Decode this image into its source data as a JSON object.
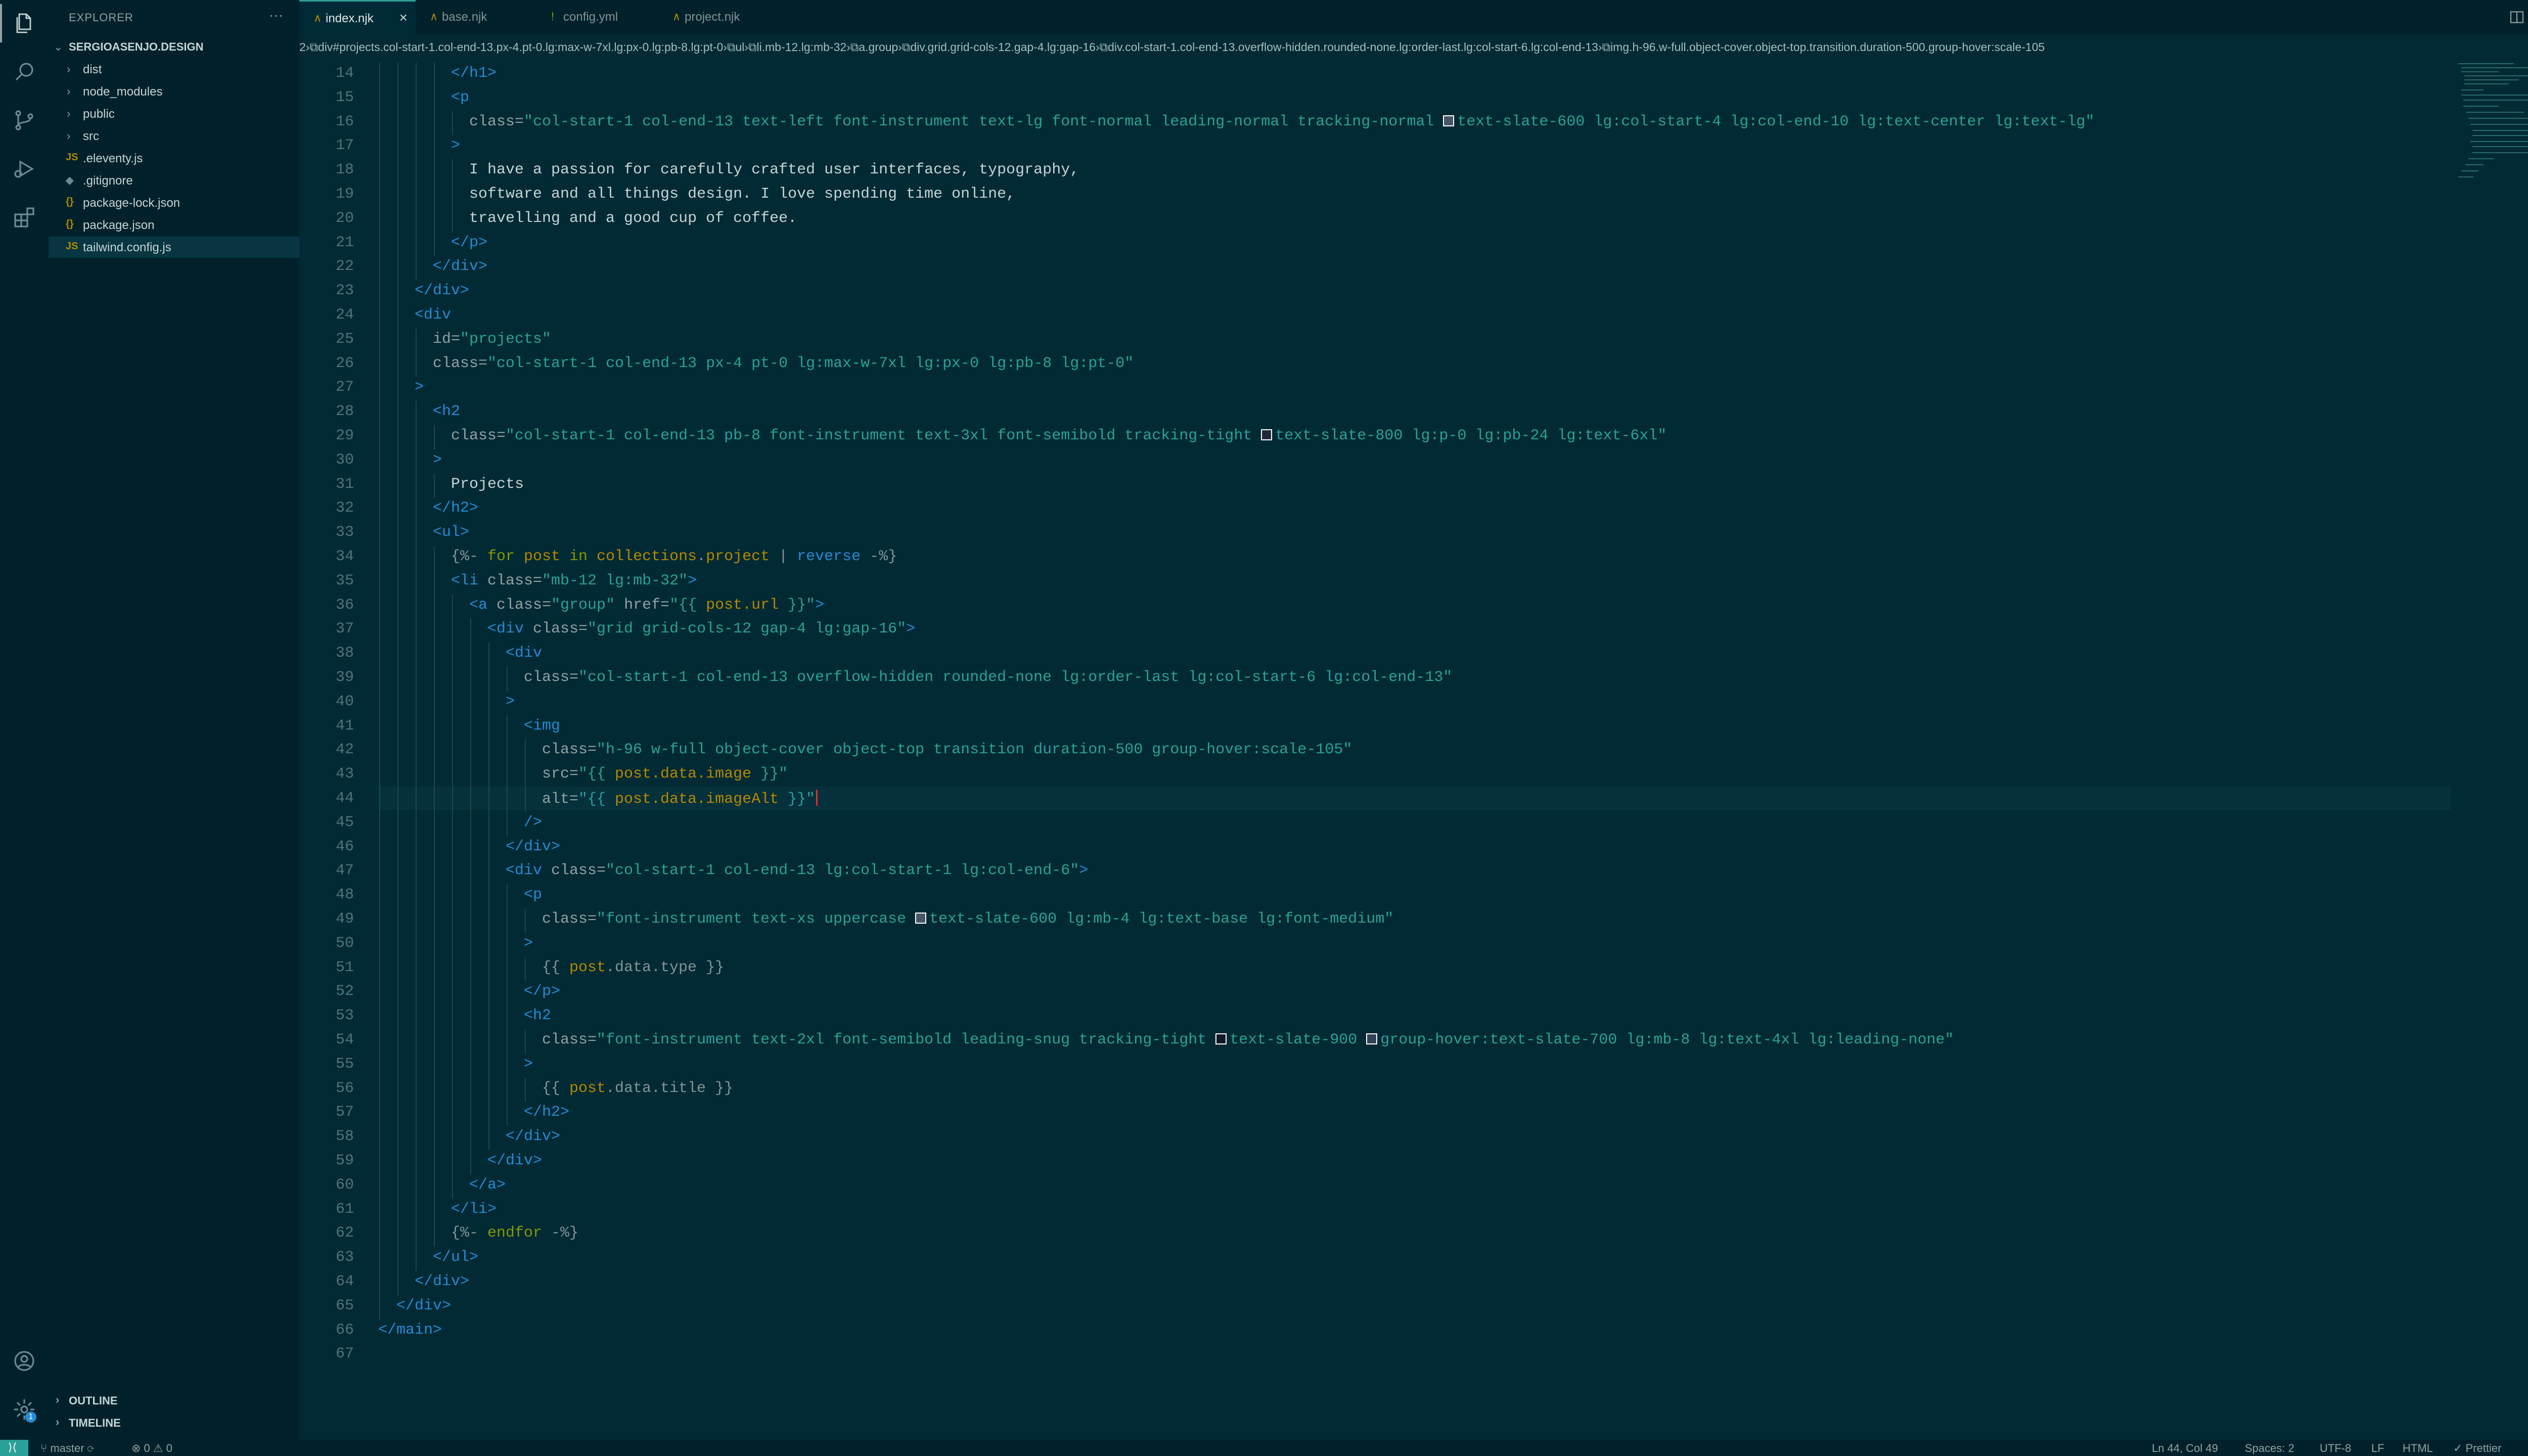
{
  "sidebar": {
    "title": "EXPLORER",
    "more": "···",
    "root": "SERGIOASENJO.DESIGN",
    "items": [
      {
        "label": "dist",
        "kind": "folder"
      },
      {
        "label": "node_modules",
        "kind": "folder"
      },
      {
        "label": "public",
        "kind": "folder"
      },
      {
        "label": "src",
        "kind": "folder"
      },
      {
        "label": ".eleventy.js",
        "kind": "js",
        "icon": "JS"
      },
      {
        "label": ".gitignore",
        "kind": "ignore",
        "icon": "◆"
      },
      {
        "label": "package-lock.json",
        "kind": "json",
        "icon": "{}"
      },
      {
        "label": "package.json",
        "kind": "json",
        "icon": "{}"
      },
      {
        "label": "tailwind.config.js",
        "kind": "js",
        "icon": "JS"
      }
    ],
    "outline": "OUTLINE",
    "timeline": "TIMELINE"
  },
  "tabs": [
    {
      "label": "index.njk",
      "icon": "∧",
      "close": "×"
    },
    {
      "label": "base.njk",
      "icon": "∧"
    },
    {
      "label": "config.yml",
      "icon": "!"
    },
    {
      "label": "project.njk",
      "icon": "∧"
    }
  ],
  "breadcrumb": [
    "2",
    "div#projects.col-start-1.col-end-13.px-4.pt-0.lg:max-w-7xl.lg:px-0.lg:pb-8.lg:pt-0",
    "ul",
    "li.mb-12.lg:mb-32",
    "a.group",
    "div.grid.grid-cols-12.gap-4.lg:gap-16",
    "div.col-start-1.col-end-13.overflow-hidden.rounded-none.lg:order-last.lg:col-start-6.lg:col-end-13",
    "img.h-96.w-full.object-cover.object-top.transition.duration-500.group-hover:scale-105"
  ],
  "editor": {
    "lines": [
      {
        "n": "14",
        "indent": 4,
        "parts": [
          [
            "t-tag",
            "</h1>"
          ]
        ]
      },
      {
        "n": "15",
        "indent": 4,
        "parts": [
          [
            "t-tag",
            "<p"
          ]
        ]
      },
      {
        "n": "16",
        "indent": 5,
        "parts": [
          [
            "t-attr",
            "class="
          ],
          [
            "t-str",
            "\"col-start-1 col-end-13 text-left font-instrument text-lg font-normal leading-normal tracking-normal "
          ],
          [
            "sw",
            "#475569"
          ],
          [
            "t-str",
            "text-slate-600 lg:col-start-4 lg:col-end-10 lg:text-center lg:text-lg\""
          ]
        ]
      },
      {
        "n": "17",
        "indent": 4,
        "parts": [
          [
            "t-tag",
            ">"
          ]
        ]
      },
      {
        "n": "18",
        "indent": 5,
        "parts": [
          [
            "t-txt",
            "I have a passion for carefully crafted user interfaces, typography,"
          ]
        ]
      },
      {
        "n": "19",
        "indent": 5,
        "parts": [
          [
            "t-txt",
            "software and all things design. I love spending time online,"
          ]
        ]
      },
      {
        "n": "20",
        "indent": 5,
        "parts": [
          [
            "t-txt",
            "travelling and a good cup of coffee."
          ]
        ]
      },
      {
        "n": "21",
        "indent": 4,
        "parts": [
          [
            "t-tag",
            "</p>"
          ]
        ]
      },
      {
        "n": "22",
        "indent": 3,
        "parts": [
          [
            "t-tag",
            "</div>"
          ]
        ]
      },
      {
        "n": "23",
        "indent": 2,
        "parts": [
          [
            "t-tag",
            "</div>"
          ]
        ]
      },
      {
        "n": "24",
        "indent": 2,
        "parts": [
          [
            "t-tag",
            "<div"
          ]
        ]
      },
      {
        "n": "25",
        "indent": 3,
        "parts": [
          [
            "t-attr",
            "id="
          ],
          [
            "t-str",
            "\"projects\""
          ]
        ]
      },
      {
        "n": "26",
        "indent": 3,
        "parts": [
          [
            "t-attr",
            "class="
          ],
          [
            "t-str",
            "\"col-start-1 col-end-13 px-4 pt-0 lg:max-w-7xl lg:px-0 lg:pb-8 lg:pt-0\""
          ]
        ]
      },
      {
        "n": "27",
        "indent": 2,
        "parts": [
          [
            "t-tag",
            ">"
          ]
        ]
      },
      {
        "n": "28",
        "indent": 3,
        "parts": [
          [
            "t-tag",
            "<h2"
          ]
        ]
      },
      {
        "n": "29",
        "indent": 4,
        "parts": [
          [
            "t-attr",
            "class="
          ],
          [
            "t-str",
            "\"col-start-1 col-end-13 pb-8 font-instrument text-3xl font-semibold tracking-tight "
          ],
          [
            "sw",
            "#1e293b"
          ],
          [
            "t-str",
            "text-slate-800 lg:p-0 lg:pb-24 lg:text-6xl\""
          ]
        ]
      },
      {
        "n": "30",
        "indent": 3,
        "parts": [
          [
            "t-tag",
            ">"
          ]
        ]
      },
      {
        "n": "31",
        "indent": 4,
        "parts": [
          [
            "t-txt",
            "Projects"
          ]
        ]
      },
      {
        "n": "32",
        "indent": 3,
        "parts": [
          [
            "t-tag",
            "</h2>"
          ]
        ]
      },
      {
        "n": "33",
        "indent": 3,
        "parts": [
          [
            "t-tag",
            "<ul>"
          ]
        ]
      },
      {
        "n": "34",
        "indent": 4,
        "parts": [
          [
            "t-op",
            "{%- "
          ],
          [
            "t-kw",
            "for "
          ],
          [
            "t-tpl",
            "post "
          ],
          [
            "t-kw",
            "in "
          ],
          [
            "t-tpl",
            "collections"
          ],
          [
            "t-op",
            "."
          ],
          [
            "t-tpl",
            "project "
          ],
          [
            "t-op",
            "| "
          ],
          [
            "t-tag",
            "reverse "
          ],
          [
            "t-op",
            "-%}"
          ]
        ]
      },
      {
        "n": "35",
        "indent": 4,
        "parts": [
          [
            "t-tag",
            "<li "
          ],
          [
            "t-attr",
            "class="
          ],
          [
            "t-str",
            "\"mb-12 lg:mb-32\""
          ],
          [
            "t-tag",
            ">"
          ]
        ]
      },
      {
        "n": "36",
        "indent": 5,
        "parts": [
          [
            "t-tag",
            "<a "
          ],
          [
            "t-attr",
            "class="
          ],
          [
            "t-str",
            "\"group\" "
          ],
          [
            "t-attr",
            "href="
          ],
          [
            "t-str",
            "\"{{ "
          ],
          [
            "t-tpl",
            "post.url"
          ],
          [
            "t-str",
            " }}\""
          ],
          [
            "t-tag",
            ">"
          ]
        ]
      },
      {
        "n": "37",
        "indent": 6,
        "parts": [
          [
            "t-tag",
            "<div "
          ],
          [
            "t-attr",
            "class="
          ],
          [
            "t-str",
            "\"grid grid-cols-12 gap-4 lg:gap-16\""
          ],
          [
            "t-tag",
            ">"
          ]
        ]
      },
      {
        "n": "38",
        "indent": 7,
        "parts": [
          [
            "t-tag",
            "<div"
          ]
        ]
      },
      {
        "n": "39",
        "indent": 8,
        "parts": [
          [
            "t-attr",
            "class="
          ],
          [
            "t-str",
            "\"col-start-1 col-end-13 overflow-hidden rounded-none lg:order-last lg:col-start-6 lg:col-end-13\""
          ]
        ]
      },
      {
        "n": "40",
        "indent": 7,
        "parts": [
          [
            "t-tag",
            ">"
          ]
        ]
      },
      {
        "n": "41",
        "indent": 8,
        "parts": [
          [
            "t-tag",
            "<img"
          ]
        ]
      },
      {
        "n": "42",
        "indent": 9,
        "parts": [
          [
            "t-attr",
            "class="
          ],
          [
            "t-str",
            "\"h-96 w-full object-cover object-top transition duration-500 group-hover:scale-105\""
          ]
        ]
      },
      {
        "n": "43",
        "indent": 9,
        "parts": [
          [
            "t-attr",
            "src="
          ],
          [
            "t-str",
            "\"{{ "
          ],
          [
            "t-tpl",
            "post.data.image"
          ],
          [
            "t-str",
            " }}\""
          ]
        ]
      },
      {
        "n": "44",
        "indent": 9,
        "parts": [
          [
            "t-attr",
            "alt="
          ],
          [
            "t-str",
            "\"{{ "
          ],
          [
            "t-tpl",
            "post.data.imageAlt"
          ],
          [
            "t-str",
            " }}\""
          ]
        ]
      },
      {
        "n": "45",
        "indent": 8,
        "parts": [
          [
            "t-tag",
            "/>"
          ]
        ]
      },
      {
        "n": "46",
        "indent": 7,
        "parts": [
          [
            "t-tag",
            "</div>"
          ]
        ]
      },
      {
        "n": "47",
        "indent": 7,
        "parts": [
          [
            "t-tag",
            "<div "
          ],
          [
            "t-attr",
            "class="
          ],
          [
            "t-str",
            "\"col-start-1 col-end-13 lg:col-start-1 lg:col-end-6\""
          ],
          [
            "t-tag",
            ">"
          ]
        ]
      },
      {
        "n": "48",
        "indent": 8,
        "parts": [
          [
            "t-tag",
            "<p"
          ]
        ]
      },
      {
        "n": "49",
        "indent": 9,
        "parts": [
          [
            "t-attr",
            "class="
          ],
          [
            "t-str",
            "\"font-instrument text-xs uppercase "
          ],
          [
            "sw",
            "#475569"
          ],
          [
            "t-str",
            "text-slate-600 lg:mb-4 lg:text-base lg:font-medium\""
          ]
        ]
      },
      {
        "n": "50",
        "indent": 8,
        "parts": [
          [
            "t-tag",
            ">"
          ]
        ]
      },
      {
        "n": "51",
        "indent": 9,
        "parts": [
          [
            "t-op",
            "{{ "
          ],
          [
            "t-tpl",
            "post"
          ],
          [
            "t-op",
            ".data.type }}"
          ]
        ]
      },
      {
        "n": "52",
        "indent": 8,
        "parts": [
          [
            "t-tag",
            "</p>"
          ]
        ]
      },
      {
        "n": "53",
        "indent": 8,
        "parts": [
          [
            "t-tag",
            "<h2"
          ]
        ]
      },
      {
        "n": "54",
        "indent": 9,
        "parts": [
          [
            "t-attr",
            "class="
          ],
          [
            "t-str",
            "\"font-instrument text-2xl font-semibold leading-snug tracking-tight "
          ],
          [
            "sw",
            "#0f172a"
          ],
          [
            "t-str",
            "text-slate-900 "
          ],
          [
            "sw",
            "#334155"
          ],
          [
            "t-str",
            "group-hover:text-slate-700 lg:mb-8 lg:text-4xl lg:leading-none\""
          ]
        ]
      },
      {
        "n": "55",
        "indent": 8,
        "parts": [
          [
            "t-tag",
            ">"
          ]
        ]
      },
      {
        "n": "56",
        "indent": 9,
        "parts": [
          [
            "t-op",
            "{{ "
          ],
          [
            "t-tpl",
            "post"
          ],
          [
            "t-op",
            ".data.title }}"
          ]
        ]
      },
      {
        "n": "57",
        "indent": 8,
        "parts": [
          [
            "t-tag",
            "</h2>"
          ]
        ]
      },
      {
        "n": "58",
        "indent": 7,
        "parts": [
          [
            "t-tag",
            "</div>"
          ]
        ]
      },
      {
        "n": "59",
        "indent": 6,
        "parts": [
          [
            "t-tag",
            "</div>"
          ]
        ]
      },
      {
        "n": "60",
        "indent": 5,
        "parts": [
          [
            "t-tag",
            "</a>"
          ]
        ]
      },
      {
        "n": "61",
        "indent": 4,
        "parts": [
          [
            "t-tag",
            "</li>"
          ]
        ]
      },
      {
        "n": "62",
        "indent": 4,
        "parts": [
          [
            "t-op",
            "{%- "
          ],
          [
            "t-kw",
            "endfor "
          ],
          [
            "t-op",
            "-%}"
          ]
        ]
      },
      {
        "n": "63",
        "indent": 3,
        "parts": [
          [
            "t-tag",
            "</ul>"
          ]
        ]
      },
      {
        "n": "64",
        "indent": 2,
        "parts": [
          [
            "t-tag",
            "</div>"
          ]
        ]
      },
      {
        "n": "65",
        "indent": 1,
        "parts": [
          [
            "t-tag",
            "</div>"
          ]
        ]
      },
      {
        "n": "66",
        "indent": 0,
        "parts": [
          [
            "t-tag",
            "</main>"
          ]
        ]
      },
      {
        "n": "67",
        "indent": 0,
        "parts": []
      }
    ],
    "current_line": "44"
  },
  "status": {
    "branch": "master",
    "errors": "0",
    "warnings": "0",
    "position": "Ln 44, Col 49",
    "spaces": "Spaces: 2",
    "encoding": "UTF-8",
    "eol": "LF",
    "language": "HTML",
    "formatter": "Prettier",
    "accounts_badge": "1"
  },
  "colors": {
    "bg": "#012a35",
    "sidebar": "#00212b",
    "accent": "#2aa198",
    "tag": "#268bd2",
    "string": "#2aa198",
    "template": "#b58900",
    "keyword": "#859900"
  }
}
